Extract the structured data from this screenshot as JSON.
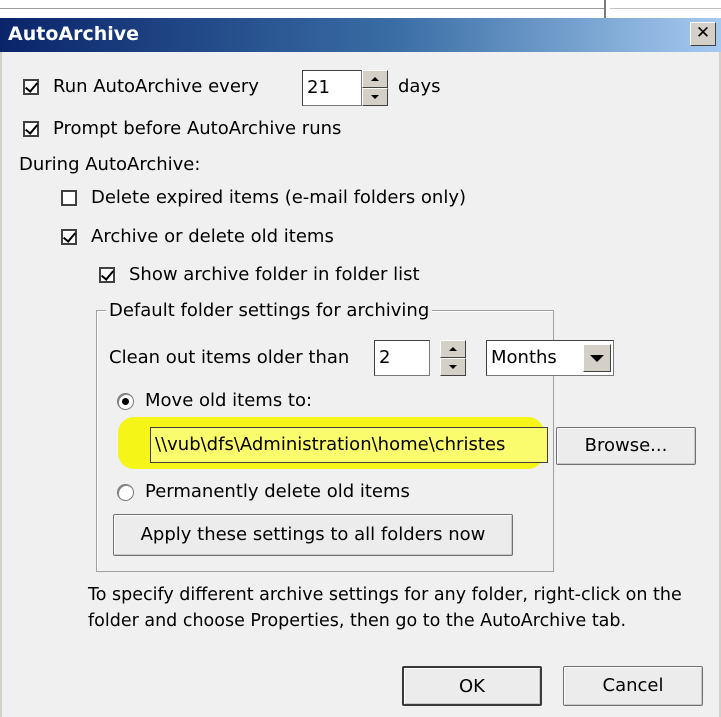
{
  "window": {
    "title": "AutoArchive",
    "close_glyph": "✕"
  },
  "run_every": {
    "label_before": "Run AutoArchive every",
    "value": "21",
    "label_after": "days",
    "checked": true
  },
  "prompt_before": {
    "label": "Prompt before AutoArchive runs",
    "checked": true
  },
  "during_label": "During AutoArchive:",
  "delete_expired": {
    "label": "Delete expired items (e-mail folders only)",
    "checked": false
  },
  "archive_old": {
    "label": "Archive or delete old items",
    "checked": true
  },
  "show_archive_folder": {
    "label": "Show archive folder in folder list",
    "checked": true
  },
  "group": {
    "title": "Default folder settings for archiving",
    "clean_out_label": "Clean out items older than",
    "clean_out_value": "2",
    "unit_selected": "Months",
    "move_old": {
      "label": "Move old items to:",
      "selected": true
    },
    "path": "\\\\vub\\dfs\\Administration\\home\\christes",
    "browse_label": "Browse...",
    "delete_permanently": {
      "label": "Permanently delete old items",
      "selected": false
    },
    "apply_label": "Apply these settings to all folders now"
  },
  "help_text": "To specify different archive settings for any folder, right-click on the folder and choose Properties, then go to the AutoArchive tab.",
  "ok_label": "OK",
  "cancel_label": "Cancel",
  "colors": {
    "highlight": "#f5f500",
    "titlebar": "#0a246a"
  }
}
